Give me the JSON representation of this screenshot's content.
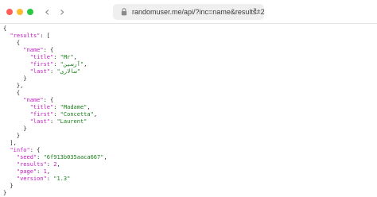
{
  "window": {
    "traffic_lights": {
      "close": "#ff5f57",
      "minimize": "#febc2e",
      "zoom": "#28c840"
    },
    "back_icon": "chevron-left-icon",
    "forward_icon": "chevron-right-icon",
    "reload_icon": "reload-icon",
    "lock_icon": "lock-icon"
  },
  "address_bar": {
    "url": "randomuser.me/api/?inc=name&results=2"
  },
  "colors": {
    "key": "#c21bc1",
    "string": "#1a7d1a",
    "punct": "#222222"
  },
  "json_view": {
    "root_key": "\"results\"",
    "people": [
      {
        "name_key": "\"name\"",
        "title_key": "\"title\"",
        "title": "\"Mr\"",
        "first_key": "\"first\"",
        "first": "\"آرسین\"",
        "last_key": "\"last\"",
        "last": "\"سالاری\""
      },
      {
        "name_key": "\"name\"",
        "title_key": "\"title\"",
        "title": "\"Madame\"",
        "first_key": "\"first\"",
        "first": "\"Concetta\"",
        "last_key": "\"last\"",
        "last": "\"Laurent\""
      }
    ],
    "info": {
      "key": "\"info\"",
      "seed_key": "\"seed\"",
      "seed": "\"6f913b035aaca667\"",
      "results_key": "\"results\"",
      "results": "2",
      "page_key": "\"page\"",
      "page": "1",
      "version_key": "\"version\"",
      "version": "\"1.3\""
    }
  }
}
